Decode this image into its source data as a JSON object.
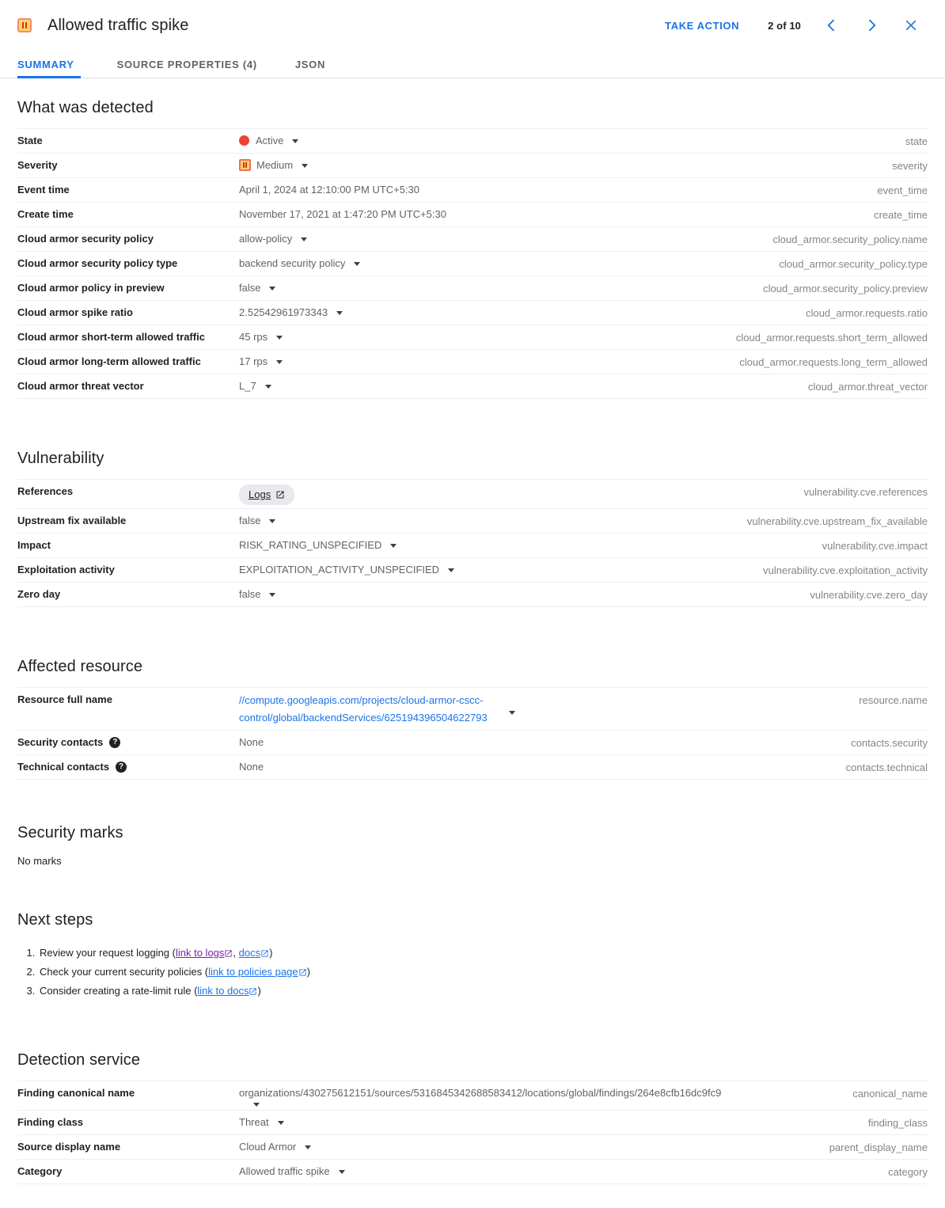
{
  "header": {
    "title": "Allowed traffic spike",
    "severity_icon": "severity-medium-icon",
    "take_action_label": "TAKE ACTION",
    "pager": "2 of 10",
    "prev_icon": "chevron-left-icon",
    "next_icon": "chevron-right-icon",
    "close_icon": "close-icon"
  },
  "tabs": [
    {
      "label": "SUMMARY",
      "active": true
    },
    {
      "label": "SOURCE PROPERTIES (4)",
      "active": false
    },
    {
      "label": "JSON",
      "active": false
    }
  ],
  "colors": {
    "accent_blue": "#1a73e8",
    "state_active_red": "#ea4335",
    "severity_fill": "#fdd663",
    "severity_border": "#e8715a",
    "visited_link_purple": "#7b1fa2",
    "key_gray": "#80868b"
  },
  "sections": {
    "what_was_detected": {
      "title": "What was detected",
      "rows": [
        {
          "label": "State",
          "value": "Active",
          "key": "state",
          "icon": "state-dot-red",
          "caret": true
        },
        {
          "label": "Severity",
          "value": "Medium",
          "key": "severity",
          "icon": "severity-medium-icon",
          "caret": true
        },
        {
          "label": "Event time",
          "value": "April 1, 2024 at 12:10:00 PM UTC+5:30",
          "key": "event_time",
          "caret": false
        },
        {
          "label": "Create time",
          "value": "November 17, 2021 at 1:47:20 PM UTC+5:30",
          "key": "create_time",
          "caret": false
        },
        {
          "label": "Cloud armor security policy",
          "value": "allow-policy",
          "key": "cloud_armor.security_policy.name",
          "caret": true
        },
        {
          "label": "Cloud armor security policy type",
          "value": "backend security policy",
          "key": "cloud_armor.security_policy.type",
          "caret": true
        },
        {
          "label": "Cloud armor policy in preview",
          "value": "false",
          "key": "cloud_armor.security_policy.preview",
          "caret": true
        },
        {
          "label": "Cloud armor spike ratio",
          "value": "2.52542961973343",
          "key": "cloud_armor.requests.ratio",
          "caret": true
        },
        {
          "label": "Cloud armor short-term allowed traffic",
          "value": "45 rps",
          "key": "cloud_armor.requests.short_term_allowed",
          "caret": true
        },
        {
          "label": "Cloud armor long-term allowed traffic",
          "value": "17 rps",
          "key": "cloud_armor.requests.long_term_allowed",
          "caret": true
        },
        {
          "label": "Cloud armor threat vector",
          "value": "L_7",
          "key": "cloud_armor.threat_vector",
          "caret": true
        }
      ]
    },
    "vulnerability": {
      "title": "Vulnerability",
      "references_label": "References",
      "references_chip": "Logs",
      "references_key": "vulnerability.cve.references",
      "rows": [
        {
          "label": "Upstream fix available",
          "value": "false",
          "key": "vulnerability.cve.upstream_fix_available",
          "caret": true
        },
        {
          "label": "Impact",
          "value": "RISK_RATING_UNSPECIFIED",
          "key": "vulnerability.cve.impact",
          "caret": true
        },
        {
          "label": "Exploitation activity",
          "value": "EXPLOITATION_ACTIVITY_UNSPECIFIED",
          "key": "vulnerability.cve.exploitation_activity",
          "caret": true
        },
        {
          "label": "Zero day",
          "value": "false",
          "key": "vulnerability.cve.zero_day",
          "caret": true
        }
      ]
    },
    "affected_resource": {
      "title": "Affected resource",
      "resource_label": "Resource full name",
      "resource_value": "//compute.googleapis.com/projects/cloud-armor-cscc-control/global/backendServices/625194396504622793",
      "resource_key": "resource.name",
      "rows": [
        {
          "label": "Security contacts",
          "value": "None",
          "key": "contacts.security",
          "help": "?"
        },
        {
          "label": "Technical contacts",
          "value": "None",
          "key": "contacts.technical",
          "help": "?"
        }
      ]
    },
    "security_marks": {
      "title": "Security marks",
      "body": "No marks"
    },
    "next_steps": {
      "title": "Next steps",
      "items": [
        {
          "prefix": "Review your request logging (",
          "links": [
            {
              "text": "link to logs",
              "visited": true
            },
            {
              "text": "docs",
              "visited": false
            }
          ],
          "separator": ", ",
          "suffix": ")"
        },
        {
          "prefix": "Check your current security policies (",
          "links": [
            {
              "text": "link to policies page",
              "visited": false
            }
          ],
          "separator": "",
          "suffix": ")"
        },
        {
          "prefix": "Consider creating a rate-limit rule (",
          "links": [
            {
              "text": "link to docs",
              "visited": false
            }
          ],
          "separator": "",
          "suffix": ")"
        }
      ]
    },
    "detection_service": {
      "title": "Detection service",
      "canonical_label": "Finding canonical name",
      "canonical_value": "organizations/430275612151/sources/5316845342688583412/locations/global/findings/264e8cfb16dc9fc9",
      "canonical_key": "canonical_name",
      "rows": [
        {
          "label": "Finding class",
          "value": "Threat",
          "key": "finding_class",
          "caret": true
        },
        {
          "label": "Source display name",
          "value": "Cloud Armor",
          "key": "parent_display_name",
          "caret": true
        },
        {
          "label": "Category",
          "value": "Allowed traffic spike",
          "key": "category",
          "caret": true
        }
      ]
    }
  }
}
